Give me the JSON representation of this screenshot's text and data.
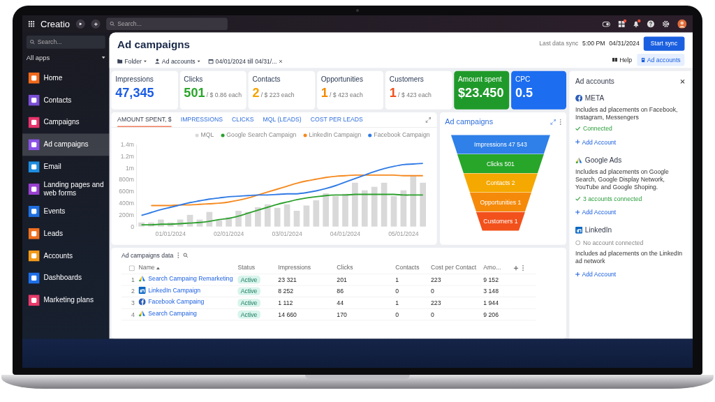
{
  "top_bar": {
    "logo": "Creatio",
    "search_placeholder": "Search..."
  },
  "sidebar": {
    "search_placeholder": "Search...",
    "section": "All apps",
    "items": [
      {
        "label": "Home",
        "color": "#f26a1b",
        "selected": false
      },
      {
        "label": "Contacts",
        "color": "#7b4fd6",
        "selected": false
      },
      {
        "label": "Campaigns",
        "color": "#e8336b",
        "selected": false
      },
      {
        "label": "Ad campaigns",
        "color": "#8a52e6",
        "selected": true
      },
      {
        "label": "Email",
        "color": "#1f8de0",
        "selected": false
      },
      {
        "label": "Landing pages and web forms",
        "color": "#9a3fd0",
        "selected": false
      },
      {
        "label": "Events",
        "color": "#1f6fe0",
        "selected": false
      },
      {
        "label": "Leads",
        "color": "#f07020",
        "selected": false
      },
      {
        "label": "Accounts",
        "color": "#f29a1a",
        "selected": false
      },
      {
        "label": "Dashboards",
        "color": "#1d6fe8",
        "selected": false
      },
      {
        "label": "Marketing plans",
        "color": "#e83a6a",
        "selected": false
      }
    ]
  },
  "header": {
    "title": "Ad campaigns",
    "filters": [
      {
        "kind": "folder",
        "label": "Folder"
      },
      {
        "kind": "accounts",
        "label": "Ad accounts"
      },
      {
        "kind": "date",
        "label": "04/01/2024 till 04/31/..."
      }
    ],
    "sync_label": "Last data sync",
    "sync_time": "5:00 PM",
    "sync_date": "04/31/2024",
    "sync_button": "Start sync",
    "help": "Help",
    "accounts_button": "Ad accounts"
  },
  "kpis": [
    {
      "kind": "plain",
      "label": "Impressions",
      "value": "47,345",
      "color": "#1a5ce5"
    },
    {
      "kind": "plain",
      "label": "Clicks",
      "value": "501",
      "note": "/ $ 0.86 each",
      "color": "#2aa52a"
    },
    {
      "kind": "plain",
      "label": "Contacts",
      "value": "2",
      "note": "/ $ 223 each",
      "color": "#f5a300"
    },
    {
      "kind": "plain",
      "label": "Opportunities",
      "value": "1",
      "note": "/ $ 423 each",
      "color": "#f58a00"
    },
    {
      "kind": "plain",
      "label": "Customers",
      "value": "1",
      "note": "/ $ 423 each",
      "color": "#f0521e"
    },
    {
      "kind": "filled",
      "label": "Amount spent",
      "value": "$23.450",
      "color": "#1f9a2a"
    },
    {
      "kind": "filled",
      "label": "CPC",
      "value": "0.5",
      "color": "#1c6df0"
    }
  ],
  "chart_tabs": [
    {
      "label": "AMOUNT SPENT, $",
      "selected": true
    },
    {
      "label": "IMPRESSIONS",
      "selected": false
    },
    {
      "label": "CLICKS",
      "selected": false
    },
    {
      "label": "MQL (LEADS)",
      "selected": false
    },
    {
      "label": "COST PER LEADS",
      "selected": false
    }
  ],
  "chart": {
    "chart_data": {
      "type": "line",
      "ylim": [
        0,
        1400
      ],
      "categories": [
        null,
        null,
        null,
        "01/01/2024",
        null,
        null,
        null,
        null,
        null,
        "02/01/2024",
        null,
        null,
        null,
        null,
        null,
        "03/01/2024",
        null,
        null,
        null,
        null,
        null,
        "04/01/2024",
        null,
        null,
        null,
        null,
        null,
        "05/01/2024",
        null,
        null
      ],
      "yticks": [
        {
          "value": 0,
          "label": "0"
        },
        {
          "value": 200,
          "label": "200m"
        },
        {
          "value": 400,
          "label": "400m"
        },
        {
          "value": 600,
          "label": "600m"
        },
        {
          "value": 800,
          "label": "800m"
        }
      ],
      "series": [
        {
          "name": "MQL",
          "type": "bar",
          "color": "#d9d9d9",
          "values": [
            70,
            70,
            120,
            70,
            120,
            200,
            120,
            250,
            110,
            160,
            270,
            250,
            330,
            380,
            320,
            380,
            270,
            360,
            450,
            570,
            520,
            560,
            750,
            620,
            680,
            750,
            520,
            620,
            870,
            750
          ]
        },
        {
          "name": "Google Search Campaign",
          "type": "line",
          "color": "#2ca02c",
          "values": [
            30,
            30,
            40,
            40,
            50,
            60,
            70,
            90,
            120,
            140,
            180,
            230,
            280,
            330,
            380,
            420,
            460,
            490,
            510,
            530,
            540,
            540,
            550,
            550,
            550,
            550,
            550,
            540,
            540,
            540
          ]
        },
        {
          "name": "LinkedIn Campaign",
          "type": "line",
          "color": "#f5891f",
          "values": [
            null,
            360,
            360,
            360,
            370,
            370,
            380,
            390,
            400,
            420,
            450,
            490,
            540,
            590,
            640,
            690,
            740,
            780,
            810,
            840,
            860,
            870,
            880,
            880,
            880,
            880,
            880,
            870,
            870,
            870
          ]
        },
        {
          "name": "Facebook Campaign",
          "type": "line",
          "color": "#2f7ae5",
          "values": [
            190,
            240,
            290,
            330,
            370,
            410,
            440,
            470,
            490,
            510,
            520,
            530,
            540,
            540,
            550,
            560,
            560,
            580,
            610,
            650,
            700,
            760,
            820,
            880,
            940,
            990,
            1030,
            1060,
            1070,
            1080
          ]
        }
      ]
    },
    "upper_y_labels": [
      "1.4m",
      "1.2m",
      "1m"
    ]
  },
  "funnel": {
    "title": "Ad campaigns",
    "stages": [
      {
        "label": "Impressions 47 543",
        "color": "#2f80e8"
      },
      {
        "label": "Clicks 501",
        "color": "#27a62a"
      },
      {
        "label": "Contacts 2",
        "color": "#f5a800"
      },
      {
        "label": "Opportunities 1",
        "color": "#f58a0a"
      },
      {
        "label": "Customers 1",
        "color": "#f2511b"
      }
    ]
  },
  "table": {
    "title": "Ad campaigns data",
    "columns": [
      {
        "label": "Name",
        "sorted": true
      },
      {
        "label": "Status",
        "sorted": false
      },
      {
        "label": "Impressions",
        "sorted": false
      },
      {
        "label": "Clicks",
        "sorted": false
      },
      {
        "label": "Contacts",
        "sorted": false
      },
      {
        "label": "Cost per Contact",
        "sorted": false
      },
      {
        "label": "Amo...",
        "sorted": false
      }
    ],
    "rows": [
      {
        "number": "1",
        "kind": "google",
        "cells": [
          "Search Campaing Remarketing",
          "Active",
          "23 321",
          "201",
          "1",
          "223",
          "9 152"
        ]
      },
      {
        "number": "2",
        "kind": "linkedin",
        "cells": [
          "LinkedIn Campaign",
          "Active",
          "8 252",
          "86",
          "0",
          "0",
          "3 148"
        ]
      },
      {
        "number": "3",
        "kind": "facebook",
        "cells": [
          "Facebook Campaing",
          "Active",
          "1 112",
          "44",
          "1",
          "223",
          "1 944"
        ]
      },
      {
        "number": "4",
        "kind": "google",
        "cells": [
          "Search Campaing",
          "Active",
          "14 660",
          "170",
          "0",
          "0",
          "9 206"
        ]
      }
    ]
  },
  "accounts_panel": {
    "title": "Ad accounts",
    "accounts": [
      {
        "kind": "facebook",
        "name": "META",
        "lines": [
          {
            "kind": "text",
            "text": "Includes ad placements on Facebook, Instagram, Messengers"
          },
          {
            "kind": "status",
            "text": "Connected",
            "connected": true
          }
        ],
        "action": "Add Account"
      },
      {
        "kind": "google",
        "name": "Google Ads",
        "lines": [
          {
            "kind": "text",
            "text": "Includes ad placements on Google Search, Google Display Network, YouTube and Google Shoping."
          },
          {
            "kind": "status",
            "text": "3 accounts connected",
            "connected": true
          }
        ],
        "action": "Add Account"
      },
      {
        "kind": "linkedin",
        "name": "LinkedIn",
        "lines": [
          {
            "kind": "status",
            "text": "No account connected",
            "connected": false
          },
          {
            "kind": "text",
            "text": "Includes ad placements on the LinkedIn ad network"
          }
        ],
        "action": "Add Account"
      }
    ]
  }
}
